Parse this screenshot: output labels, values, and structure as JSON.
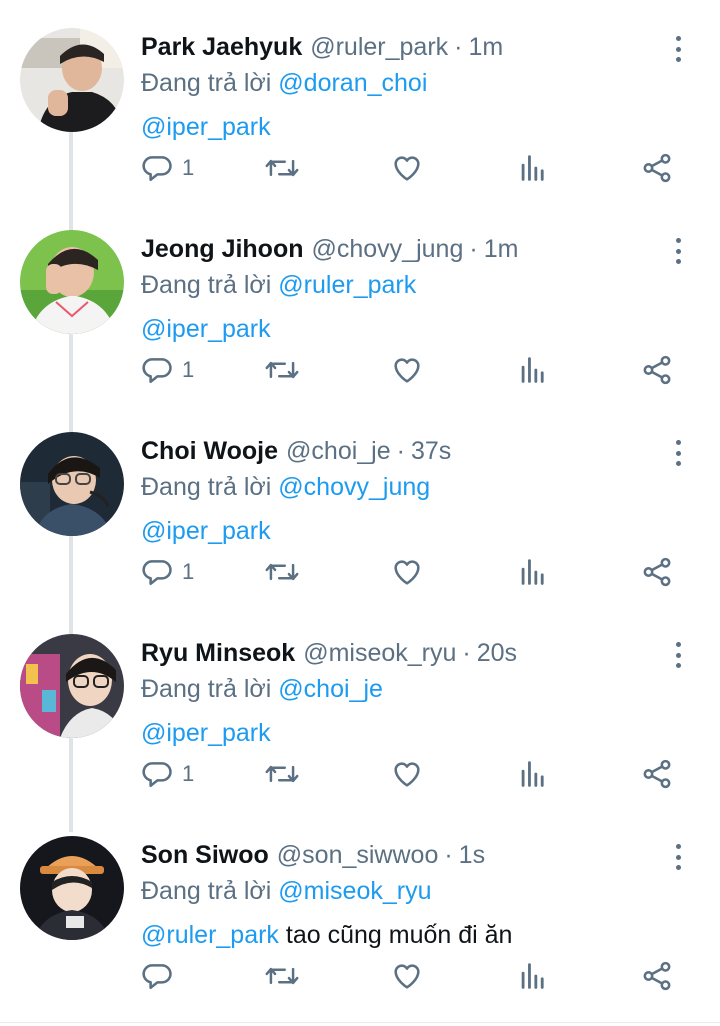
{
  "reply_prefix": "Đang trả lời",
  "tweets": [
    {
      "name": "Park Jaehyuk",
      "handle": "@ruler_park",
      "time": "1m",
      "reply_to": "@doran_choi",
      "mention": "@iper_park",
      "text": "",
      "reply_count": "1"
    },
    {
      "name": "Jeong Jihoon",
      "handle": "@chovy_jung",
      "time": "1m",
      "reply_to": "@ruler_park",
      "mention": "@iper_park",
      "text": "",
      "reply_count": "1"
    },
    {
      "name": "Choi Wooje",
      "handle": "@choi_je",
      "time": "37s",
      "reply_to": "@chovy_jung",
      "mention": "@iper_park",
      "text": "",
      "reply_count": "1"
    },
    {
      "name": "Ryu Minseok",
      "handle": "@miseok_ryu",
      "time": "20s",
      "reply_to": "@choi_je",
      "mention": "@iper_park",
      "text": "",
      "reply_count": "1"
    },
    {
      "name": "Son Siwoo",
      "handle": "@son_siwwoo",
      "time": "1s",
      "reply_to": "@miseok_ryu",
      "mention": "@ruler_park",
      "text": "tao cũng muốn đi ăn",
      "reply_count": ""
    }
  ],
  "colors": {
    "accent": "#1d9bf0",
    "muted": "#5b7083",
    "thread_line": "#e1e4e6"
  },
  "icons": [
    "reply-icon",
    "retweet-icon",
    "like-icon",
    "stats-icon",
    "share-icon",
    "more-icon"
  ]
}
